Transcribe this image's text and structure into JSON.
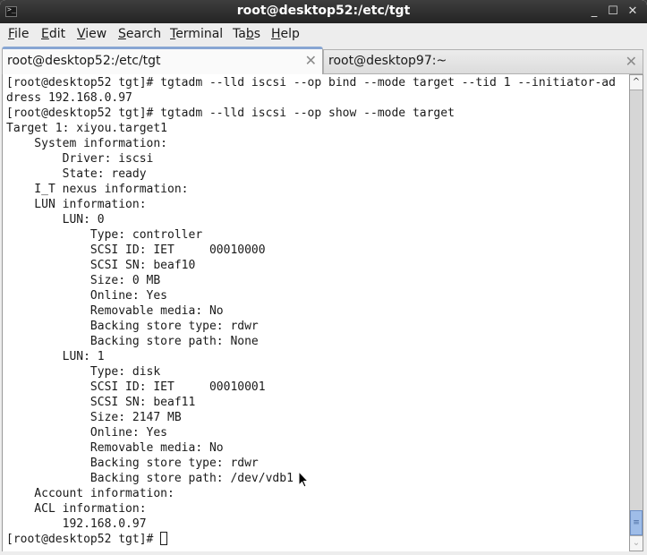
{
  "window": {
    "title": "root@desktop52:/etc/tgt",
    "controls": {
      "minimize": "_",
      "maximize": "☐",
      "close": "✕"
    }
  },
  "menubar": {
    "items": [
      {
        "label": "File",
        "mnemonic": "F"
      },
      {
        "label": "Edit",
        "mnemonic": "E"
      },
      {
        "label": "View",
        "mnemonic": "V"
      },
      {
        "label": "Search",
        "mnemonic": "S"
      },
      {
        "label": "Terminal",
        "mnemonic": "T"
      },
      {
        "label": "Tabs",
        "mnemonic": "b"
      },
      {
        "label": "Help",
        "mnemonic": "H"
      }
    ]
  },
  "tabs": [
    {
      "label": "root@desktop52:/etc/tgt",
      "active": true,
      "close": "✕"
    },
    {
      "label": "root@desktop97:~",
      "active": false,
      "close": "✕"
    }
  ],
  "terminal": {
    "lines": [
      "[root@desktop52 tgt]# tgtadm --lld iscsi --op bind --mode target --tid 1 --initiator-ad",
      "dress 192.168.0.97",
      "[root@desktop52 tgt]# tgtadm --lld iscsi --op show --mode target",
      "Target 1: xiyou.target1",
      "    System information:",
      "        Driver: iscsi",
      "        State: ready",
      "    I_T nexus information:",
      "    LUN information:",
      "        LUN: 0",
      "            Type: controller",
      "            SCSI ID: IET     00010000",
      "            SCSI SN: beaf10",
      "            Size: 0 MB",
      "            Online: Yes",
      "            Removable media: No",
      "            Backing store type: rdwr",
      "            Backing store path: None",
      "        LUN: 1",
      "            Type: disk",
      "            SCSI ID: IET     00010001",
      "            SCSI SN: beaf11",
      "            Size: 2147 MB",
      "            Online: Yes",
      "            Removable media: No",
      "            Backing store type: rdwr",
      "            Backing store path: /dev/vdb1",
      "    Account information:",
      "    ACL information:",
      "        192.168.0.97"
    ],
    "prompt": "[root@desktop52 tgt]# "
  },
  "scrollbar": {
    "position": "bottom"
  }
}
